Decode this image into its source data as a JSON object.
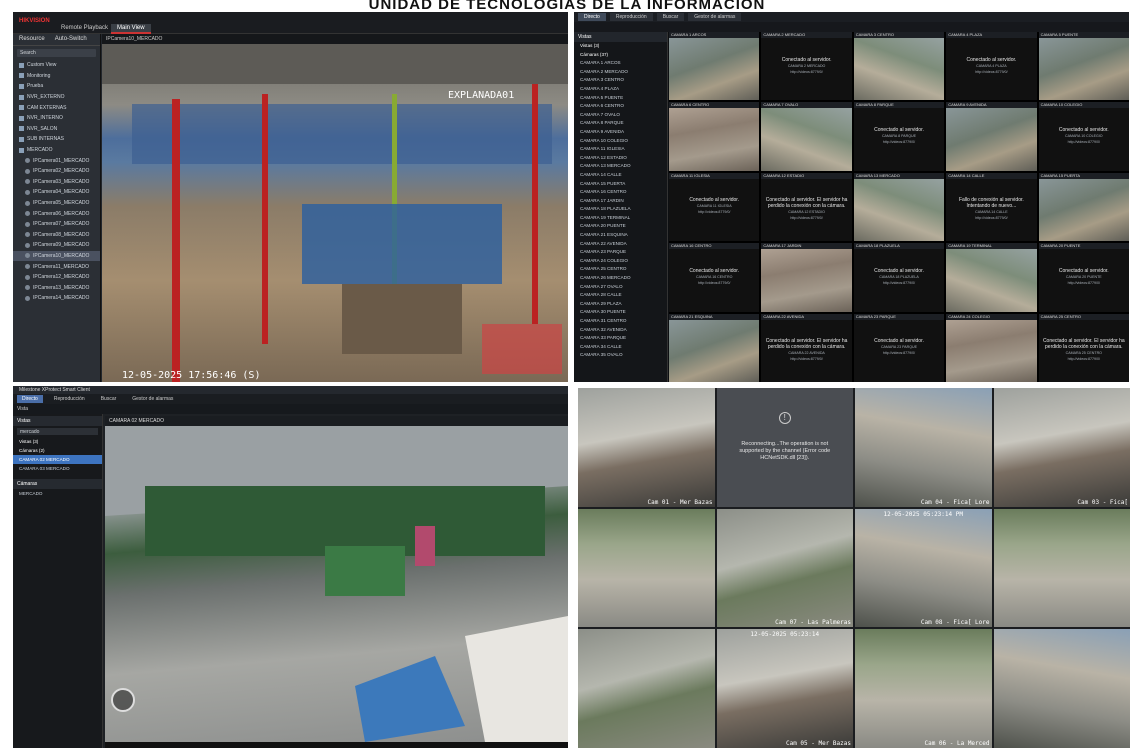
{
  "banner": {
    "title": "UNIDAD DE TECNOLOGIAS DE LA INFORMACION"
  },
  "p1": {
    "app_logo": "HIKVISION",
    "tabs": [
      {
        "label": "Remote Playback"
      },
      {
        "label": "Main View"
      }
    ],
    "side_tabs": [
      "Resource",
      "Auto-Switch"
    ],
    "search_placeholder": "Search",
    "items": [
      {
        "label": "Custom View",
        "kind": "sq"
      },
      {
        "label": "Monitoring",
        "kind": "sq"
      },
      {
        "label": "Prueba",
        "kind": "sq"
      },
      {
        "label": "NVR_EXTERNO",
        "kind": "sq"
      },
      {
        "label": "CAM EXTERNAS",
        "kind": "sq"
      },
      {
        "label": "NVR_INTERNO",
        "kind": "sq"
      },
      {
        "label": "NVR_SALON",
        "kind": "sq"
      },
      {
        "label": "SUB INTERNAS",
        "kind": "sq"
      },
      {
        "label": "MERCADO",
        "kind": "sq"
      },
      {
        "label": "IPCamera01_MERCADO",
        "kind": "dot"
      },
      {
        "label": "IPCamera02_MERCADO",
        "kind": "dot"
      },
      {
        "label": "IPCamera03_MERCADO",
        "kind": "dot"
      },
      {
        "label": "IPCamera04_MERCADO",
        "kind": "dot"
      },
      {
        "label": "IPCamera05_MERCADO",
        "kind": "dot"
      },
      {
        "label": "IPCamera06_MERCADO",
        "kind": "dot"
      },
      {
        "label": "IPCamera07_MERCADO",
        "kind": "dot"
      },
      {
        "label": "IPCamera08_MERCADO",
        "kind": "dot"
      },
      {
        "label": "IPCamera09_MERCADO",
        "kind": "dot"
      },
      {
        "label": "IPCamera10_MERCADO",
        "kind": "dot",
        "selected": true
      },
      {
        "label": "IPCamera11_MERCADO",
        "kind": "dot"
      },
      {
        "label": "IPCamera12_MERCADO",
        "kind": "dot"
      },
      {
        "label": "IPCamera13_MERCADO",
        "kind": "dot"
      },
      {
        "label": "IPCamera14_MERCADO",
        "kind": "dot"
      }
    ],
    "video_caption": "IPCamera10_MERCADO",
    "overlay_name": "EXPLANADA01",
    "overlay_time": "12-05-2025 17:56:46 (S)"
  },
  "p2": {
    "tabs": [
      "Directo",
      "Reproducción",
      "Buscar",
      "Gestor de alarmas"
    ],
    "side_header": "Vistas",
    "side_sub": "Vistas (3)",
    "side_sub2": "Cámaras (37)",
    "cameras": [
      "CAMARA 1 ARCOS",
      "CAMARA 2 MERCADO",
      "CAMARA 3 CENTRO",
      "CAMARA 4 PLAZA",
      "CAMARA 5 PUENTE",
      "CAMARA 6 CENTRO",
      "CAMARA 7 OVALO",
      "CAMARA 8 PARQUE",
      "CAMARA 9 AVENIDA",
      "CAMARA 10 COLEGIO",
      "CAMARA 11 IGLESIA",
      "CAMARA 12 ESTADIO",
      "CAMARA 13 MERCADO",
      "CAMARA 14 CALLE",
      "CAMARA 15 PUERTA",
      "CAMARA 16 CENTRO",
      "CAMARA 17 JARDIN",
      "CAMARA 18 PLAZUELA",
      "CAMARA 19 TERMINAL",
      "CAMARA 20 PUENTE",
      "CAMARA 21 ESQUINA",
      "CAMARA 22 AVENIDA",
      "CAMARA 23 PARQUE",
      "CAMARA 24 COLEGIO",
      "CAMARA 25 CENTRO",
      "CAMARA 26 MERCADO",
      "CAMARA 27 OVALO",
      "CAMARA 28 CALLE",
      "CAMARA 29 PLAZA",
      "CAMARA 30 PUENTE",
      "CAMARA 31 CENTRO",
      "CAMARA 32 AVENIDA",
      "CAMARA 33 PARQUE",
      "CAMARA 34 CALLE",
      "CAMARA 35 OVALO"
    ],
    "cells": [
      {
        "cap": "CAMARA 1 ARCOS",
        "type": "img"
      },
      {
        "cap": "CAMARA 2 MERCADO",
        "type": "msg",
        "msg": "Conectado al servidor.",
        "sub": "CAMARA 2 MERCADO\nhttp://videos:8779/0/"
      },
      {
        "cap": "CAMARA 3 CENTRO",
        "type": "img2"
      },
      {
        "cap": "CAMARA 4 PLAZA",
        "type": "msg",
        "msg": "Conectado al servidor.",
        "sub": "CAMARA 4 PLAZA\nhttp://videos:8779/0/"
      },
      {
        "cap": "CAMARA 5 PUENTE",
        "type": "img"
      },
      {
        "cap": "CAMARA 6 CENTRO",
        "type": "img3"
      },
      {
        "cap": "CAMARA 7 OVALO",
        "type": "img2"
      },
      {
        "cap": "CAMARA 8 PARQUE",
        "type": "msg",
        "msg": "Conectado al servidor.",
        "sub": "CAMARA 8 PARQUE\nhttp://videos:8779/0/"
      },
      {
        "cap": "CAMARA 9 AVENIDA",
        "type": "img"
      },
      {
        "cap": "CAMARA 10 COLEGIO",
        "type": "msg",
        "msg": "Conectado al servidor.",
        "sub": "CAMARA 10 COLEGIO\nhttp://videos:8779/0/"
      },
      {
        "cap": "CAMARA 11 IGLESIA",
        "type": "msg",
        "msg": "Conectado al servidor.",
        "sub": "CAMARA 11 IGLESIA\nhttp://videos:8779/0/"
      },
      {
        "cap": "CAMARA 12 ESTADIO",
        "type": "msg",
        "msg": "Conectado al servidor. El servidor ha perdido la conexión con la cámara.",
        "sub": "CAMARA 12 ESTADIO\nhttp://videos:8779/0/"
      },
      {
        "cap": "CAMARA 13 MERCADO",
        "type": "img2"
      },
      {
        "cap": "CAMARA 14 CALLE",
        "type": "msg",
        "msg": "Fallo de conexión al servidor. Intentando de nuevo...",
        "sub": "CAMARA 14 CALLE\nhttp://videos:8779/0/"
      },
      {
        "cap": "CAMARA 15 PUERTA",
        "type": "img"
      },
      {
        "cap": "CAMARA 16 CENTRO",
        "type": "msg",
        "msg": "Conectado al servidor.",
        "sub": "CAMARA 16 CENTRO\nhttp://videos:8779/0/"
      },
      {
        "cap": "CAMARA 17 JARDIN",
        "type": "img3"
      },
      {
        "cap": "CAMARA 18 PLAZUELA",
        "type": "msg",
        "msg": "Conectado al servidor.",
        "sub": "CAMARA 18 PLAZUELA\nhttp://videos:8779/0/"
      },
      {
        "cap": "CAMARA 19 TERMINAL",
        "type": "img2"
      },
      {
        "cap": "CAMARA 20 PUENTE",
        "type": "msg",
        "msg": "Conectado al servidor.",
        "sub": "CAMARA 20 PUENTE\nhttp://videos:8779/0/"
      },
      {
        "cap": "CAMARA 21 ESQUINA",
        "type": "img"
      },
      {
        "cap": "CAMARA 22 AVENIDA",
        "type": "msg",
        "msg": "Conectado al servidor. El servidor ha perdido la conexión con la cámara.",
        "sub": "CAMARA 22 AVENIDA\nhttp://videos:8779/0/"
      },
      {
        "cap": "CAMARA 23 PARQUE",
        "type": "msg",
        "msg": "Conectado al servidor.",
        "sub": "CAMARA 23 PARQUE\nhttp://videos:8779/0/"
      },
      {
        "cap": "CAMARA 24 COLEGIO",
        "type": "img3"
      },
      {
        "cap": "CAMARA 25 CENTRO",
        "type": "msg",
        "msg": "Conectado al servidor. El servidor ha perdido la conexión con la cámara.",
        "sub": "CAMARA 25 CENTRO\nhttp://videos:8779/0/"
      }
    ]
  },
  "p3": {
    "title": "Milestone XProtect Smart Client",
    "tabs": [
      "Directo",
      "Reproducción",
      "Buscar",
      "Gestor de alarmas"
    ],
    "toolbar": "Vista",
    "views_header": "Vistas",
    "views_filter": "mercado",
    "views_group": "Vistas (3)",
    "cameras_group": "Cámaras (2)",
    "camera_rows": [
      {
        "label": "CAMARA 02 MERCADO",
        "selected": true
      },
      {
        "label": "CAMARA 03 MERCADO",
        "selected": false
      }
    ],
    "cameras_header": "Cámaras",
    "tree_item": "MERCADO",
    "video_caption": "CAMARA 02 MERCADO"
  },
  "p4": {
    "feeds": [
      {
        "ts": "",
        "lbl": "Cam 01 - Mer Bazas",
        "type": "a"
      },
      {
        "ts": "",
        "lbl": "",
        "type": "err",
        "msg": "Reconnecting...The operation is not supported by the channel (Error code HCNetSDK.dll [23])."
      },
      {
        "ts": "",
        "lbl": "Cam 04 - Fica[ Lore",
        "type": "c"
      },
      {
        "ts": "",
        "lbl": "Cam 03 - Fica[",
        "type": "a"
      },
      {
        "ts": "",
        "lbl": "",
        "type": "b"
      },
      {
        "ts": "",
        "lbl": "Cam 07 - Las Palmeras",
        "type": "d"
      },
      {
        "ts": "12-05-2025 05:23:14 PM",
        "lbl": "Cam 08 - Fica[ Lore",
        "type": "c"
      },
      {
        "ts": "",
        "lbl": "",
        "type": "b"
      },
      {
        "ts": "",
        "lbl": "",
        "type": "d"
      },
      {
        "ts": "12-05-2025 05:23:14",
        "lbl": "Cam 05 - Mer Bazas",
        "type": "a"
      },
      {
        "ts": "",
        "lbl": "Cam 06 - La Merced",
        "type": "b"
      },
      {
        "ts": "",
        "lbl": "",
        "type": "c"
      }
    ]
  }
}
